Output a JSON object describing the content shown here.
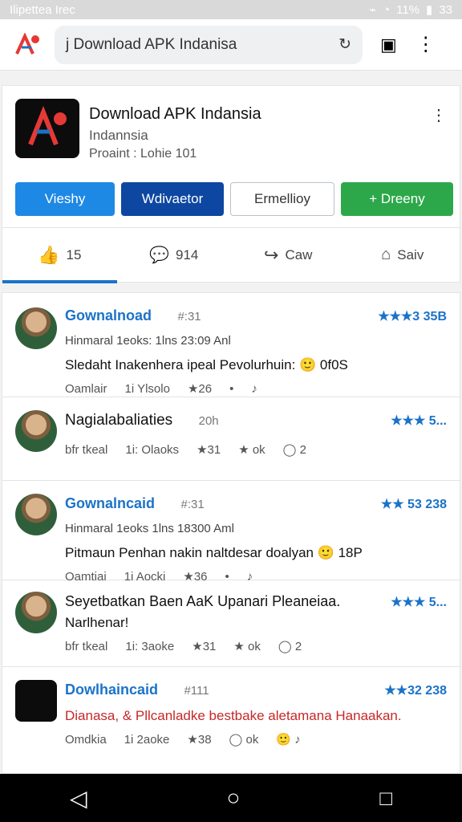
{
  "status": {
    "left": "Ilipettea Irec",
    "battery": "11%",
    "time": "33"
  },
  "url_bar": {
    "text": "j Download APK Indanisa"
  },
  "app": {
    "title": "Download APK Indansia",
    "subtitle": "Indannsia",
    "meta": "Proaint : Lohie 101",
    "buttons": [
      "Vieshy",
      "Wdivaetor",
      "Ermellioy",
      "+ Dreeny"
    ],
    "tabs": [
      {
        "label": "15",
        "icon": "like-icon"
      },
      {
        "label": "914",
        "icon": "comment-icon"
      },
      {
        "label": "Caw",
        "icon": "share-icon"
      },
      {
        "label": "Saiv",
        "icon": "save-icon"
      }
    ]
  },
  "posts": [
    {
      "author": "Gownalnoad",
      "time": "#:31",
      "rating": "★★★3 35B",
      "meta": "Hinmaral 1eoks: 1lns 23:09   Anl",
      "text": "Sledaht Inakenhera ipeal Pevolurhuin: 🙂 0f0S",
      "actions": [
        "Oamlair",
        "1i Ylsolo",
        "★26",
        "•",
        "♪"
      ]
    },
    {
      "author": "Nagialabaliaties",
      "time": "20h",
      "rating": "★★★ 5...",
      "meta": "",
      "text": "",
      "actions": [
        "bfr tkeal",
        "1i: Olaoks",
        "★31",
        "★ ok",
        "◯ 2"
      ]
    },
    {
      "author": "Gownalncaid",
      "time": "#:31",
      "rating": "★★ 53 238",
      "meta": "Hinmaral 1eoks 1lns 18300   Aml",
      "text": "Pitmaun Penhan nakin naltdesar doalyan 🙂 18P",
      "actions": [
        "Oamtiai",
        "1i Aocki",
        "★36",
        "•",
        "♪"
      ]
    },
    {
      "author": "Seyetbatkan Baen AaK Upanari Pleaneiaa.",
      "time": "",
      "rating": "★★★ 5...",
      "meta": "Narlhenar!",
      "text": "",
      "actions": [
        "bfr tkeal",
        "1i: 3aoke",
        "★31",
        "★ ok",
        "◯ 2"
      ]
    },
    {
      "author": "Dowlhaincaid",
      "time": "#111",
      "rating": "★★32 238",
      "meta": "",
      "text": "Dianasa, & Pllcanladke bestbake aletamana Hanaakan.",
      "actions": [
        "Omdkia",
        "1i 2aoke",
        "★38",
        "◯ ok",
        "🙂 ♪"
      ]
    }
  ],
  "bottom_nav": {
    "buttons": [
      "back",
      "home",
      "recents"
    ]
  }
}
